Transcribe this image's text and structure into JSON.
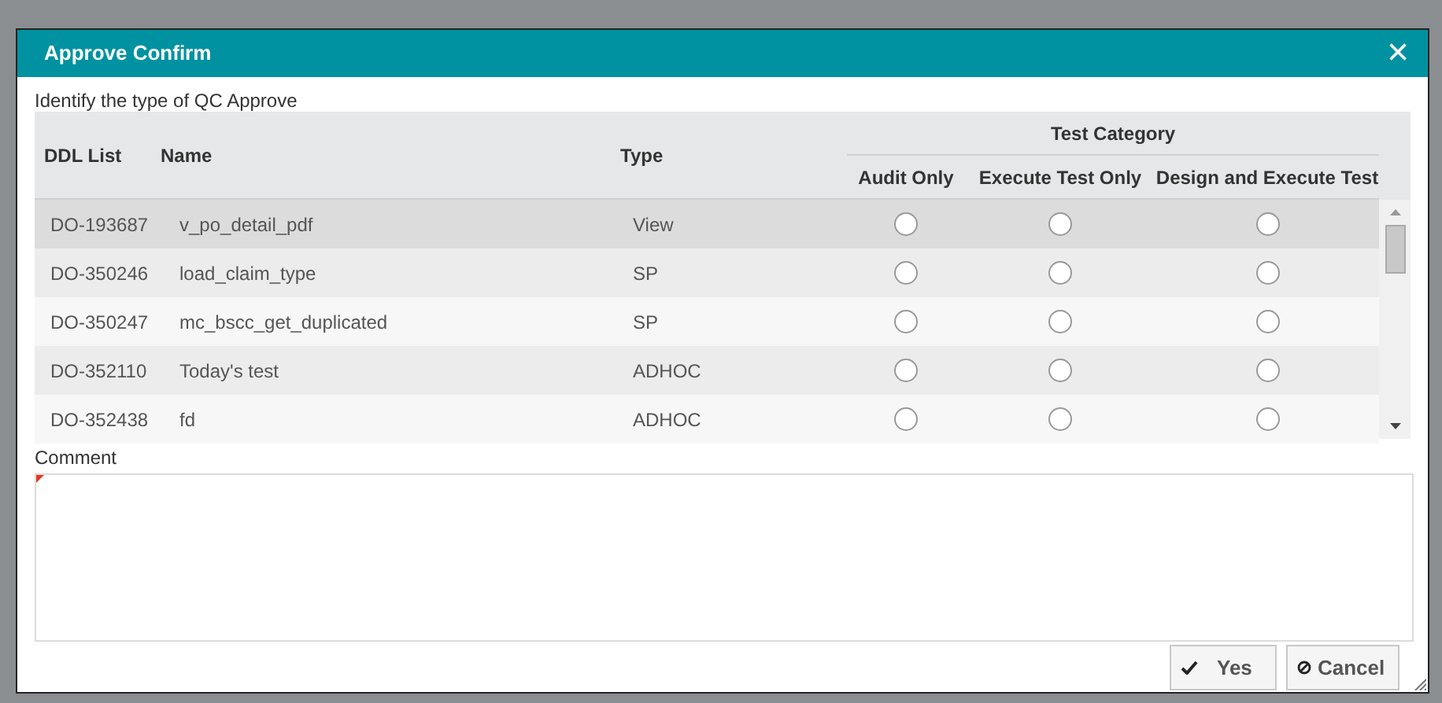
{
  "dialog": {
    "title": "Approve Confirm",
    "close_glyph": "×"
  },
  "instruction": "Identify the type of QC Approve",
  "table": {
    "columns": [
      "DDL List",
      "Name",
      "Type"
    ],
    "group_header": "Test Category",
    "sub_columns": [
      "Audit Only",
      "Execute Test Only",
      "Design and Execute Test"
    ],
    "rows": [
      {
        "ddl": "DO-193687",
        "name": "v_po_detail_pdf",
        "type": "View",
        "hovered": true,
        "choices": [
          {
            "selected": false
          },
          {
            "selected": false
          },
          {
            "selected": false
          }
        ]
      },
      {
        "ddl": "DO-350246",
        "name": "load_claim_type",
        "type": "SP",
        "hovered": false,
        "choices": [
          {
            "selected": false
          },
          {
            "selected": false
          },
          {
            "selected": false
          }
        ]
      },
      {
        "ddl": "DO-350247",
        "name": "mc_bscc_get_duplicated",
        "type": "SP",
        "hovered": false,
        "choices": [
          {
            "selected": false
          },
          {
            "selected": false
          },
          {
            "selected": false
          }
        ]
      },
      {
        "ddl": "DO-352110",
        "name": "Today's test",
        "type": "ADHOC",
        "hovered": false,
        "choices": [
          {
            "selected": false
          },
          {
            "selected": false
          },
          {
            "selected": false
          }
        ]
      },
      {
        "ddl": "DO-352438",
        "name": "fd",
        "type": "ADHOC",
        "hovered": false,
        "choices": [
          {
            "selected": false
          },
          {
            "selected": false
          },
          {
            "selected": false
          }
        ]
      }
    ]
  },
  "comment": {
    "label": "Comment",
    "required": true
  },
  "buttons": [
    {
      "kind": "confirm",
      "label": "Yes"
    },
    {
      "kind": "cancel",
      "label": "Cancel"
    }
  ]
}
